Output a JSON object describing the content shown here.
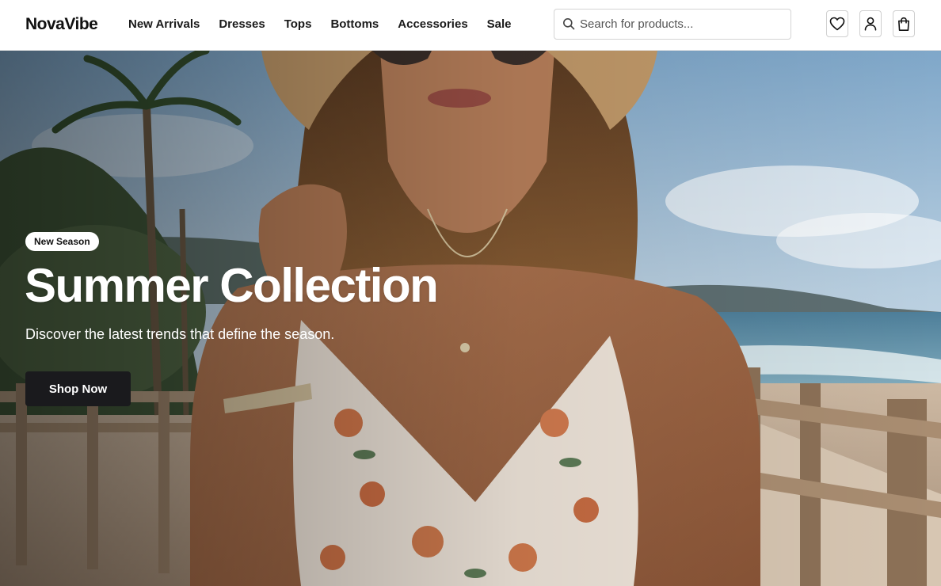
{
  "brand": {
    "name": "NovaVibe"
  },
  "nav": {
    "items": [
      {
        "label": "New Arrivals"
      },
      {
        "label": "Dresses"
      },
      {
        "label": "Tops"
      },
      {
        "label": "Bottoms"
      },
      {
        "label": "Accessories"
      },
      {
        "label": "Sale"
      }
    ]
  },
  "search": {
    "placeholder": "Search for products...",
    "value": "",
    "icon": "search-icon"
  },
  "header_actions": [
    {
      "icon": "heart-icon",
      "label": "Wishlist"
    },
    {
      "icon": "user-icon",
      "label": "Account"
    },
    {
      "icon": "shopping-bag-icon",
      "label": "Cart"
    }
  ],
  "hero": {
    "badge": "New Season",
    "title": "Summer Collection",
    "subtitle": "Discover the latest trends that define the season.",
    "cta_label": "Shop Now"
  },
  "colors": {
    "brand_text": "#111111",
    "cta_background": "#1a1a1d",
    "cta_text": "#ffffff",
    "badge_background": "#ffffff"
  }
}
